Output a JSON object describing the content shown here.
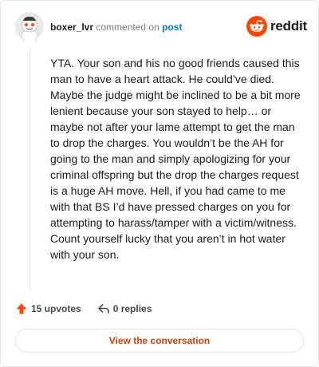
{
  "comment": {
    "author": "boxer_lvr",
    "action_text": "commented on",
    "post_link_text": "post",
    "body": "YTA. Your son and his no good friends caused this man to have a heart attack. He could’ve died. Maybe the judge might be inclined to be a bit more lenient because your son stayed to help… or maybe not after your lame attempt to get the man to drop the charges. You wouldn’t be the AH for going to the man and simply apologizing for your criminal offspring but the drop the charges request is a huge AH move. Hell, if you had came to me with that BS I’d have pressed charges on you for attempting to harass/tamper with a victim/witness. Count yourself lucky that you aren’t in hot water with your son."
  },
  "brand": {
    "name": "reddit",
    "color": "#ff4500"
  },
  "stats": {
    "upvotes": "15 upvotes",
    "replies": "0 replies"
  },
  "footer": {
    "view_conversation_label": "View the conversation"
  },
  "icons": {
    "avatar": "snoo-avatar-icon",
    "logo": "reddit-logo-icon",
    "upvote": "upvote-arrow-icon",
    "reply": "reply-arrow-icon"
  },
  "colors": {
    "link": "#0079d3",
    "upvote": "#ff4500",
    "button_text": "#d93a00"
  }
}
